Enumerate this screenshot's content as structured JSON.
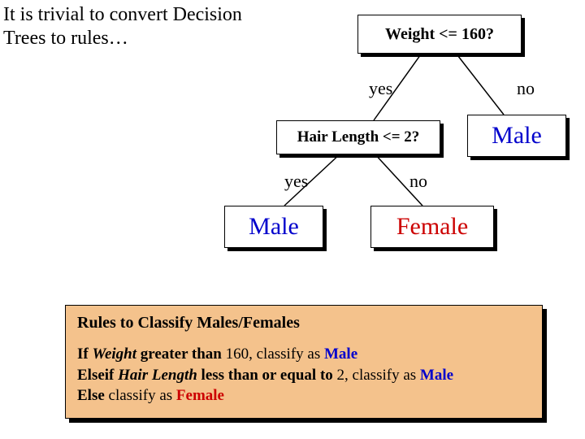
{
  "title": "It is trivial to convert Decision Trees to rules…",
  "tree": {
    "root": {
      "question": "Weight <= 160?",
      "yes_label": "yes",
      "no_label": "no",
      "no_leaf": "Male",
      "yes_child": {
        "question": "Hair Length <= 2?",
        "yes_label": "yes",
        "no_label": "no",
        "yes_leaf": "Male",
        "no_leaf": "Female"
      }
    }
  },
  "rules": {
    "header": "Rules to Classify Males/Females",
    "r1": {
      "kw1": "If",
      "attr": "Weight",
      "cond": " greater than",
      "val": " 160,",
      "act": " classify as ",
      "cls": "Male"
    },
    "r2": {
      "kw1": "Elseif",
      "attr": "Hair Length",
      "cond": " less than or equal to",
      "val": " 2,",
      "act": " classify as ",
      "cls": "Male"
    },
    "r3": {
      "kw1": "Else",
      "act": " classify as ",
      "cls": "Female"
    }
  }
}
